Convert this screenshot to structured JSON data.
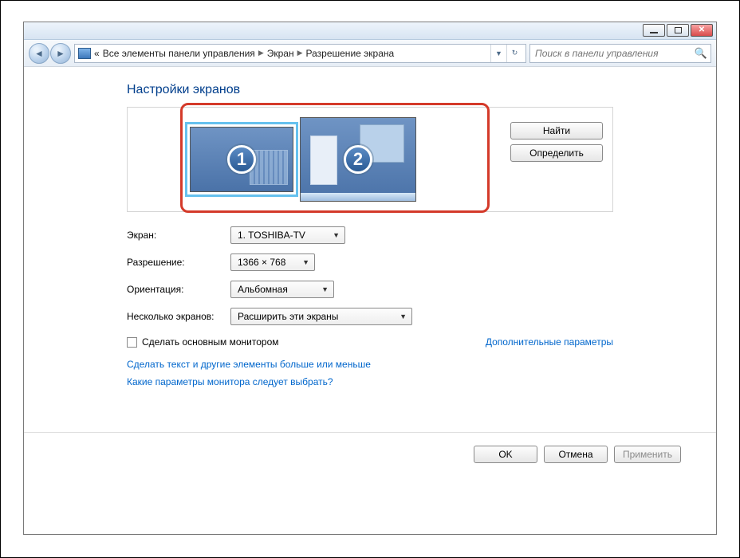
{
  "breadcrumb": {
    "leading": "«",
    "items": [
      "Все элементы панели управления",
      "Экран",
      "Разрешение экрана"
    ]
  },
  "search": {
    "placeholder": "Поиск в панели управления"
  },
  "page_title": "Настройки экранов",
  "side_buttons": {
    "find": "Найти",
    "identify": "Определить"
  },
  "displays": {
    "primary_num": "1",
    "secondary_num": "2"
  },
  "form": {
    "display_label": "Экран:",
    "display_value": "1. TOSHIBA-TV",
    "resolution_label": "Разрешение:",
    "resolution_value": "1366 × 768",
    "orient_label": "Ориентация:",
    "orient_value": "Альбомная",
    "multi_label": "Несколько экранов:",
    "multi_value": "Расширить эти экраны"
  },
  "checkbox": {
    "label": "Сделать основным монитором"
  },
  "adv_link": "Дополнительные параметры",
  "link1": "Сделать текст и другие элементы больше или меньше",
  "link2": "Какие параметры монитора следует выбрать?",
  "footer": {
    "ok": "OK",
    "cancel": "Отмена",
    "apply": "Применить"
  }
}
